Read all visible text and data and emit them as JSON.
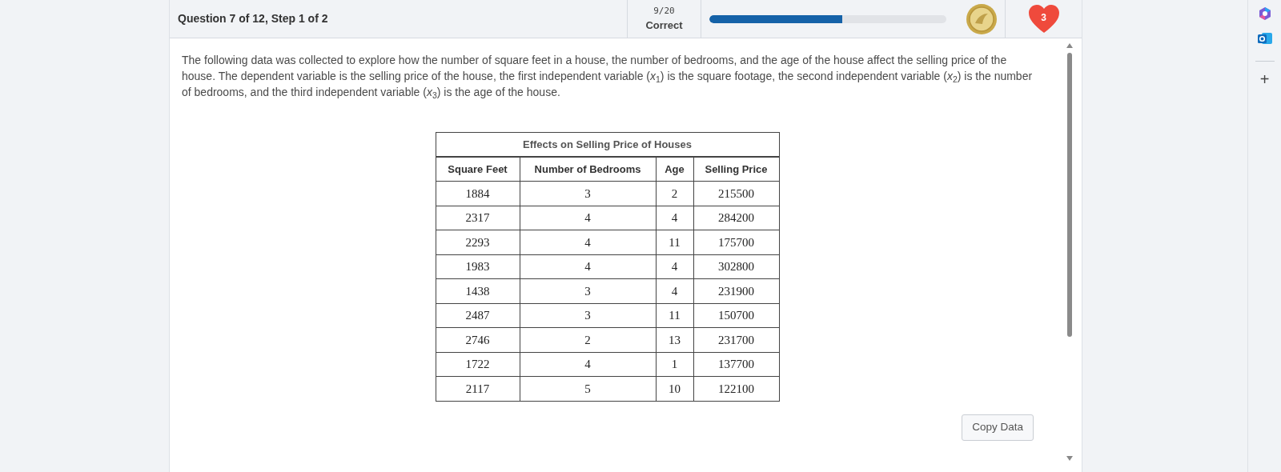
{
  "header": {
    "question": "Question 7 of 12, Step 1 of 2",
    "score": "9/20",
    "score_label": "Correct",
    "progress": {
      "level": 0.56
    },
    "lives": "3"
  },
  "question_text": "The following data was collected to explore how the number of square feet in a house, the number of bedrooms, and the age of the house affect the selling price of the house. The dependent variable is the selling price of the house, the first independent variable (*x*$_{1}$) is the square footage, the second independent variable (*x*$_{2}$) is the number of bedrooms, and the third independent variable (*x*$_{3}$) is the age of the house.",
  "table": {
    "title": "Effects on Selling Price of Houses",
    "columns": [
      "Square Feet",
      "Number of Bedrooms",
      "Age",
      "Selling Price"
    ],
    "rows": [
      [
        "1884",
        "3",
        "2",
        "215500"
      ],
      [
        "2317",
        "4",
        "4",
        "284200"
      ],
      [
        "2293",
        "4",
        "11",
        "175700"
      ],
      [
        "1983",
        "4",
        "4",
        "302800"
      ],
      [
        "1438",
        "3",
        "4",
        "231900"
      ],
      [
        "2487",
        "3",
        "11",
        "150700"
      ],
      [
        "2746",
        "2",
        "13",
        "231700"
      ],
      [
        "1722",
        "4",
        "1",
        "137700"
      ],
      [
        "2117",
        "5",
        "10",
        "122100"
      ]
    ]
  },
  "copy_button": "Copy Data",
  "sidebar": {
    "add": "+"
  }
}
